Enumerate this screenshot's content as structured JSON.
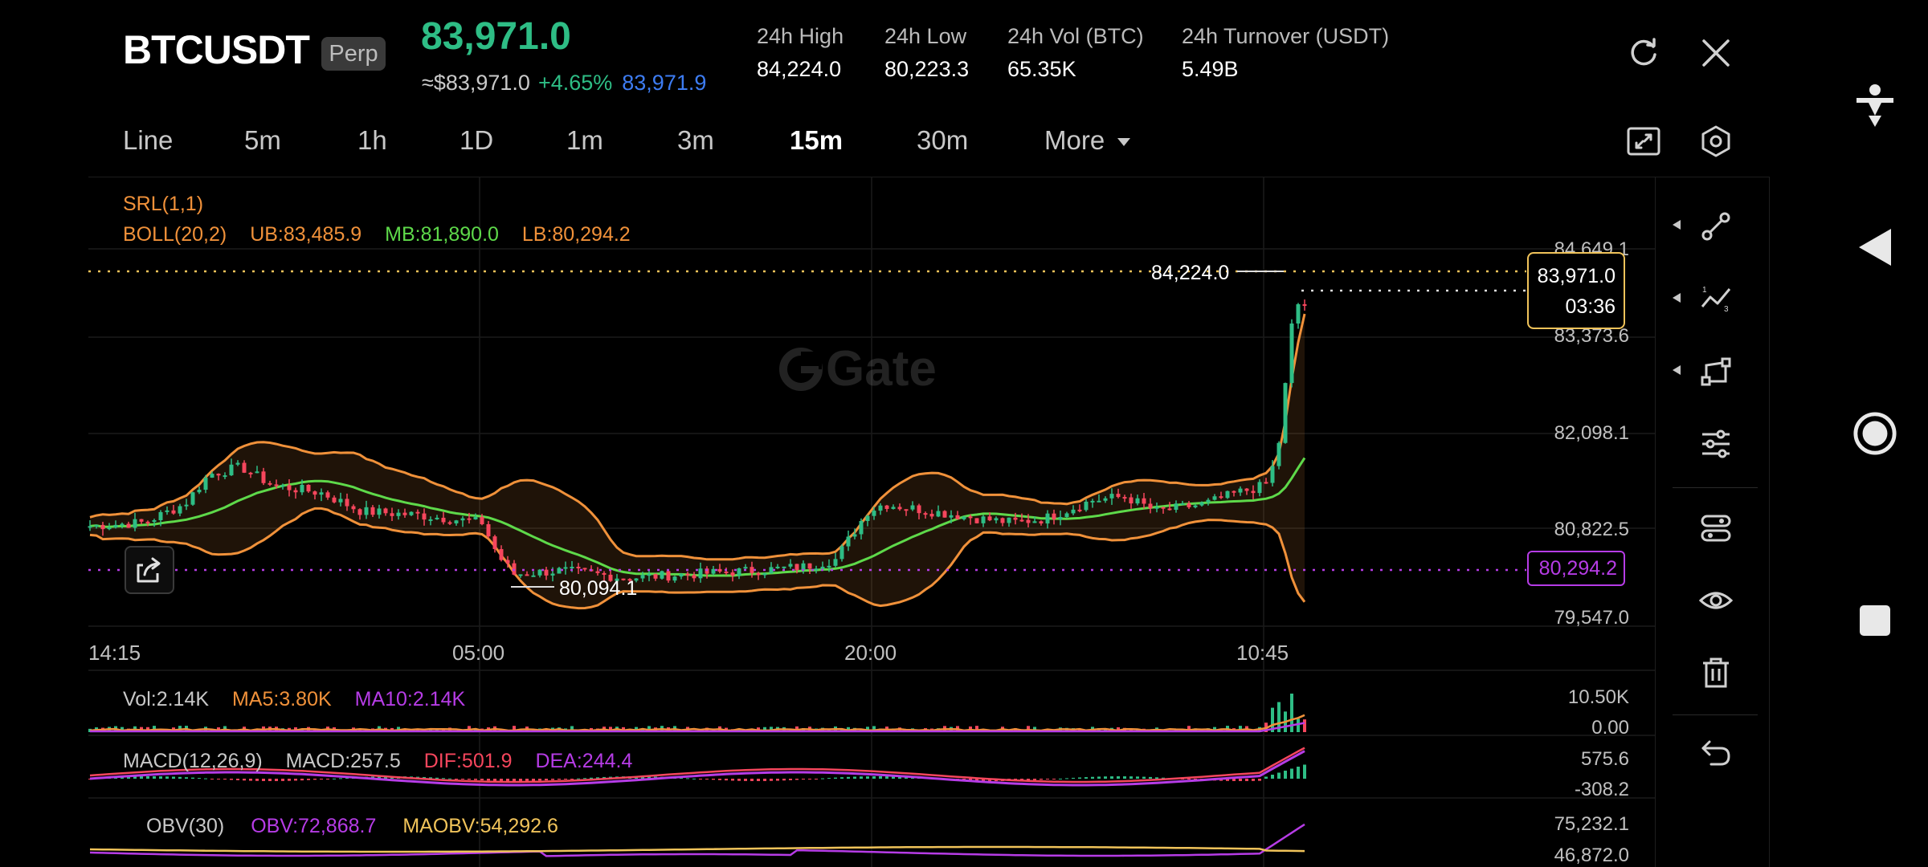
{
  "header": {
    "symbol": "BTCUSDT",
    "contract_type": "Perp",
    "last_price": "83,971.0",
    "usd_price": "≈$83,971.0",
    "change_pct": "+4.65%",
    "mark_price": "83,971.9",
    "stats": [
      {
        "label": "24h High",
        "value": "84,224.0"
      },
      {
        "label": "24h Low",
        "value": "80,223.3"
      },
      {
        "label": "24h Vol (BTC)",
        "value": "65.35K"
      },
      {
        "label": "24h Turnover (USDT)",
        "value": "5.49B"
      }
    ]
  },
  "timeframes": [
    "Line",
    "5m",
    "1h",
    "1D",
    "1m",
    "3m",
    "15m",
    "30m"
  ],
  "active_timeframe": "15m",
  "more_label": "More",
  "indicators": {
    "srl": "SRL(1,1)",
    "boll": "BOLL(20,2)",
    "ub": "UB:83,485.9",
    "mb": "MB:81,890.0",
    "lb": "LB:80,294.2",
    "vol": "Vol:2.14K",
    "ma5": "MA5:3.80K",
    "ma10": "MA10:2.14K",
    "macd_name": "MACD(12,26,9)",
    "macd_val": "MACD:257.5",
    "dif": "DIF:501.9",
    "dea": "DEA:244.4",
    "obv_name": "OBV(30)",
    "obv_val": "OBV:72,868.7",
    "maobv": "MAOBV:54,292.6"
  },
  "price_axis": [
    "84,649.1",
    "83,373.6",
    "82,098.1",
    "80,822.5",
    "79,547.0"
  ],
  "time_axis": [
    "14:15",
    "05:00",
    "20:00",
    "10:45"
  ],
  "annotations": {
    "high_marker": "84,224.0",
    "low_marker": "80,094.1",
    "current_price": "83,971.0",
    "countdown": "03:36",
    "lb_tag": "80,294.2"
  },
  "vol_axis": [
    "10.50K",
    "0.00"
  ],
  "macd_axis": [
    "575.6",
    "-308.2"
  ],
  "obv_axis": [
    "75,232.1",
    "46,872.0"
  ],
  "watermark": "Gate",
  "colors": {
    "up": "#2ebd85",
    "down": "#f6465d",
    "boll_band": "#f0913a",
    "mid_band": "#5ed94a",
    "accent_purple": "#b63ce6",
    "accent_blue": "#3d7cf2",
    "current_box": "#f0c35a"
  }
}
